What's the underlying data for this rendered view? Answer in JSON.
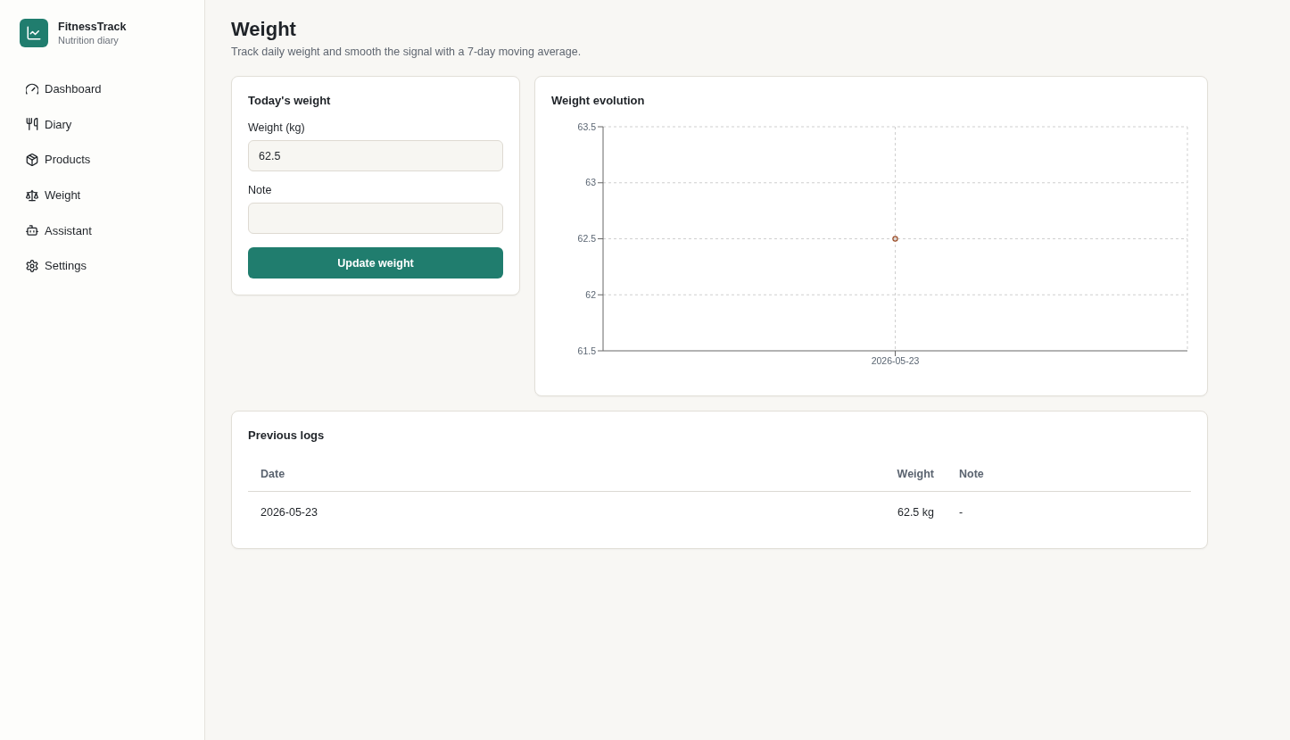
{
  "sidebar": {
    "app_name": "FitnessTrack",
    "app_subtitle": "Nutrition diary",
    "items": [
      "Dashboard",
      "Diary",
      "Products",
      "Weight",
      "Assistant",
      "Settings"
    ]
  },
  "header": {
    "title": "Weight",
    "subtitle": "Track daily weight and smooth the signal with a 7-day moving average."
  },
  "entry_card": {
    "title": "Today's weight",
    "fields": [
      {
        "label": "Weight (kg)",
        "value": "62.5"
      },
      {
        "label": "Note"
      }
    ],
    "button": "Update weight"
  },
  "chart_card": {
    "title": "Weight evolution",
    "chart_data": {
      "type": "line",
      "categories": [
        "2026-05-23"
      ],
      "series": [
        {
          "color": "#a0522d",
          "marker": "circle",
          "values": [
            62.5
          ]
        }
      ],
      "ylim": [
        61.5,
        63.5
      ],
      "yticks": [
        61.5,
        62,
        62.5,
        63,
        63.5
      ],
      "grid": true
    }
  },
  "logs_card": {
    "title": "Previous logs",
    "columns": [
      "Date",
      "Weight",
      "Note"
    ],
    "rows": [
      [
        "2026-05-23",
        "62.5 kg",
        "-"
      ]
    ]
  }
}
